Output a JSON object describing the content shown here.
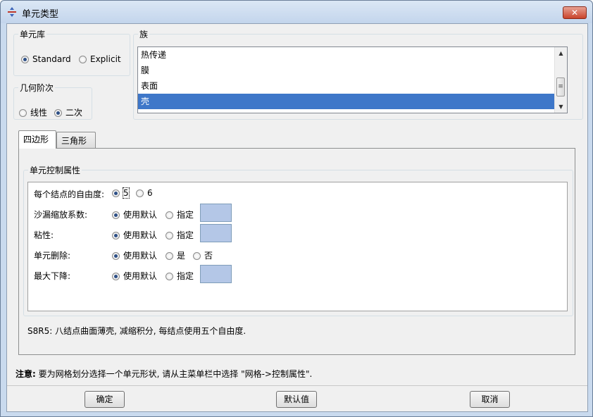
{
  "window": {
    "title": "单元类型",
    "close_label": "✕"
  },
  "library": {
    "legend": "单元库",
    "options": [
      "Standard",
      "Explicit"
    ],
    "selected": 0
  },
  "order": {
    "legend": "几何阶次",
    "options": [
      "线性",
      "二次"
    ],
    "selected": 1
  },
  "family": {
    "legend": "族",
    "items": [
      "热传递",
      "膜",
      "表面",
      "壳"
    ],
    "selected": 3
  },
  "tabs": [
    "四边形",
    "三角形"
  ],
  "controls": {
    "legend": "单元控制属性",
    "dof_label": "每个结点的自由度:",
    "dof_options": [
      "5",
      "6"
    ],
    "hourglass_label": "沙漏缩放系数:",
    "viscosity_label": "粘性:",
    "deletion_label": "单元删除:",
    "max_degradation_label": "最大下降:",
    "use_default": "使用默认",
    "specify": "指定",
    "yes": "是",
    "no": "否"
  },
  "description": "S8R5:  八结点曲面薄壳, 减缩积分, 每结点使用五个自由度.",
  "note": {
    "prefix": "注意:",
    "text": "要为网格划分选择一个单元形状, 请从主菜单栏中选择 \"网格->控制属性\"."
  },
  "buttons": {
    "ok": "确定",
    "defaults": "默认值",
    "cancel": "取消"
  },
  "colors": {
    "selection": "#3e77c9",
    "input_fill": "#b4c7e7",
    "close_button": "#c9442b"
  },
  "icons": [
    "app-logo-icon",
    "close-icon",
    "scroll-up-icon",
    "scroll-down-icon"
  ]
}
